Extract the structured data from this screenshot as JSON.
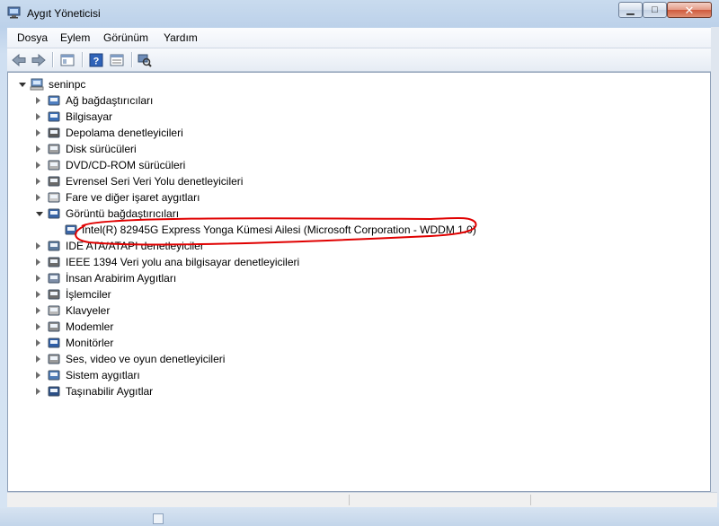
{
  "window": {
    "title": "Aygıt Yöneticisi",
    "buttons": {
      "minimize_glyph": "▁",
      "maximize_glyph": "□",
      "close_glyph": "✕"
    }
  },
  "menu": {
    "items": [
      "Dosya",
      "Eylem",
      "Görünüm",
      "Yardım"
    ]
  },
  "toolbar": {
    "buttons": [
      "back-icon",
      "forward-icon",
      "console-tree-icon",
      "help-icon",
      "properties-icon",
      "scan-hardware-icon"
    ]
  },
  "tree": {
    "root": "seninpc",
    "categories": [
      {
        "label": "Ağ bağdaştırıcıları",
        "icon": "network-adapter-icon",
        "expanded": false
      },
      {
        "label": "Bilgisayar",
        "icon": "computer-icon",
        "expanded": false
      },
      {
        "label": "Depolama denetleyicileri",
        "icon": "storage-controller-icon",
        "expanded": false
      },
      {
        "label": "Disk sürücüleri",
        "icon": "disk-drive-icon",
        "expanded": false
      },
      {
        "label": "DVD/CD-ROM sürücüleri",
        "icon": "dvd-drive-icon",
        "expanded": false
      },
      {
        "label": "Evrensel Seri Veri Yolu denetleyicileri",
        "icon": "usb-controller-icon",
        "expanded": false
      },
      {
        "label": "Fare ve diğer işaret aygıtları",
        "icon": "mouse-icon",
        "expanded": false
      },
      {
        "label": "Görüntü bağdaştırıcıları",
        "icon": "display-adapter-icon",
        "expanded": true,
        "children": [
          "Intel(R) 82945G Express Yonga Kümesi Ailesi (Microsoft Corporation - WDDM 1.0)"
        ]
      },
      {
        "label": "IDE ATA/ATAPI denetleyiciler",
        "icon": "ide-controller-icon",
        "expanded": false
      },
      {
        "label": "IEEE 1394 Veri yolu ana bilgisayar denetleyicileri",
        "icon": "ieee1394-icon",
        "expanded": false
      },
      {
        "label": "İnsan Arabirim Aygıtları",
        "icon": "hid-icon",
        "expanded": false
      },
      {
        "label": "İşlemciler",
        "icon": "processor-icon",
        "expanded": false
      },
      {
        "label": "Klavyeler",
        "icon": "keyboard-icon",
        "expanded": false
      },
      {
        "label": "Modemler",
        "icon": "modem-icon",
        "expanded": false
      },
      {
        "label": "Monitörler",
        "icon": "monitor-icon",
        "expanded": false
      },
      {
        "label": "Ses, video ve oyun denetleyicileri",
        "icon": "sound-icon",
        "expanded": false
      },
      {
        "label": "Sistem aygıtları",
        "icon": "system-device-icon",
        "expanded": false
      },
      {
        "label": "Taşınabilir Aygıtlar",
        "icon": "portable-device-icon",
        "expanded": false
      }
    ]
  },
  "annotation": {
    "color": "#e00000"
  }
}
